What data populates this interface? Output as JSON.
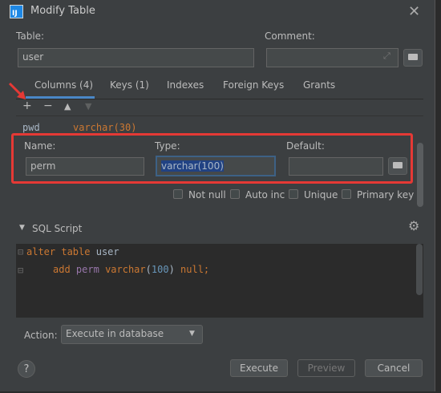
{
  "window": {
    "title": "Modify Table"
  },
  "table": {
    "label": "Table:",
    "value": "user"
  },
  "comment": {
    "label": "Comment:",
    "value": ""
  },
  "tabs": [
    {
      "label": "Columns (4)"
    },
    {
      "label": "Keys (1)"
    },
    {
      "label": "Indexes"
    },
    {
      "label": "Foreign Keys"
    },
    {
      "label": "Grants"
    }
  ],
  "toolbar": {
    "add": "+",
    "remove": "−",
    "up": "▲",
    "down": "▼"
  },
  "columns_list": [
    {
      "name": "pwd",
      "type": "varchar(30)"
    }
  ],
  "column_editor": {
    "name_label": "Name:",
    "name_value": "perm",
    "type_label": "Type:",
    "type_value": "varchar(100)",
    "default_label": "Default:",
    "default_value": ""
  },
  "checkboxes": [
    {
      "label": "Not null",
      "checked": false
    },
    {
      "label": "Auto inc",
      "checked": false
    },
    {
      "label": "Unique",
      "checked": false
    },
    {
      "label": "Primary key",
      "checked": false
    }
  ],
  "sql_section": {
    "label": "SQL Script"
  },
  "sql_lines": [
    {
      "kw1": "alter table",
      "ident": "user"
    },
    {
      "kw": "add",
      "col": "perm",
      "type": "varchar",
      "open": "(",
      "num": "100",
      "close": ")",
      "tail": "null;"
    }
  ],
  "action": {
    "label": "Action:",
    "value": "Execute in database"
  },
  "buttons": {
    "execute": "Execute",
    "preview": "Preview",
    "cancel": "Cancel",
    "help": "?"
  }
}
